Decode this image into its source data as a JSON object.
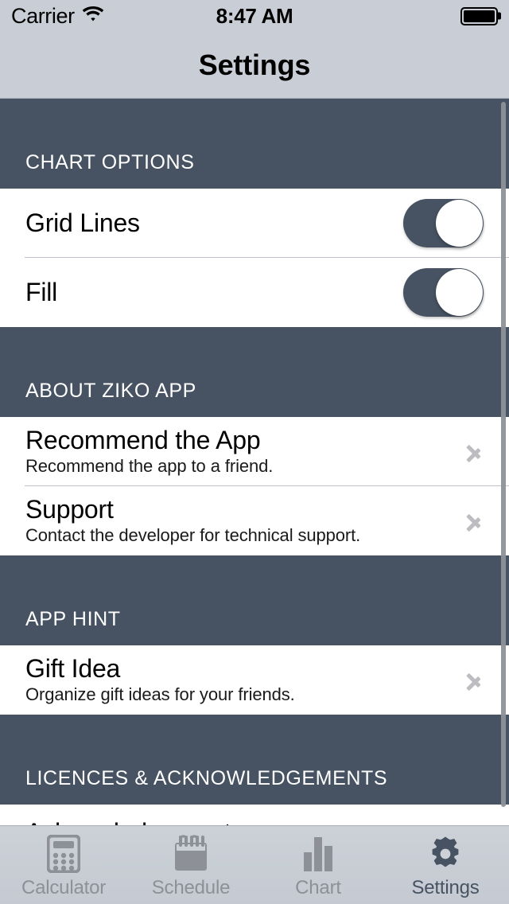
{
  "status_bar": {
    "carrier": "Carrier",
    "wifi_icon": "wifi-icon",
    "time": "8:47 AM",
    "battery_icon": "battery-full-icon"
  },
  "navbar": {
    "title": "Settings"
  },
  "colors": {
    "section_header_bg": "#475362",
    "navbar_bg": "#c9ced6",
    "tabbar_bg": "#c9ced6",
    "switch_on": "#475362",
    "chevron": "#bcbcc1",
    "accent": "#475362"
  },
  "sections": [
    {
      "header": "CHART OPTIONS",
      "rows": [
        {
          "title": "Grid Lines",
          "subtitle": "",
          "accessory": "switch",
          "value": "on"
        },
        {
          "title": "Fill",
          "subtitle": "",
          "accessory": "switch",
          "value": "on"
        }
      ]
    },
    {
      "header": "ABOUT ZIKO APP",
      "rows": [
        {
          "title": "Recommend the App",
          "subtitle": "Recommend the app to a friend.",
          "accessory": "chevron",
          "value": ""
        },
        {
          "title": "Support",
          "subtitle": "Contact the developer for technical support.",
          "accessory": "chevron",
          "value": ""
        }
      ]
    },
    {
      "header": "APP HINT",
      "rows": [
        {
          "title": "Gift Idea",
          "subtitle": "Organize gift ideas for your friends.",
          "accessory": "chevron",
          "value": ""
        }
      ]
    },
    {
      "header": "LICENCES & ACKNOWLEDGEMENTS",
      "rows": [
        {
          "title": "Acknowledgements",
          "subtitle": "",
          "accessory": "chevron",
          "value": ""
        }
      ]
    }
  ],
  "tabbar": {
    "tabs": [
      {
        "label": "Calculator",
        "icon": "calculator-icon",
        "selected": false
      },
      {
        "label": "Schedule",
        "icon": "calendar-icon",
        "selected": false
      },
      {
        "label": "Chart",
        "icon": "bar-chart-icon",
        "selected": false
      },
      {
        "label": "Settings",
        "icon": "gear-icon",
        "selected": true
      }
    ]
  }
}
